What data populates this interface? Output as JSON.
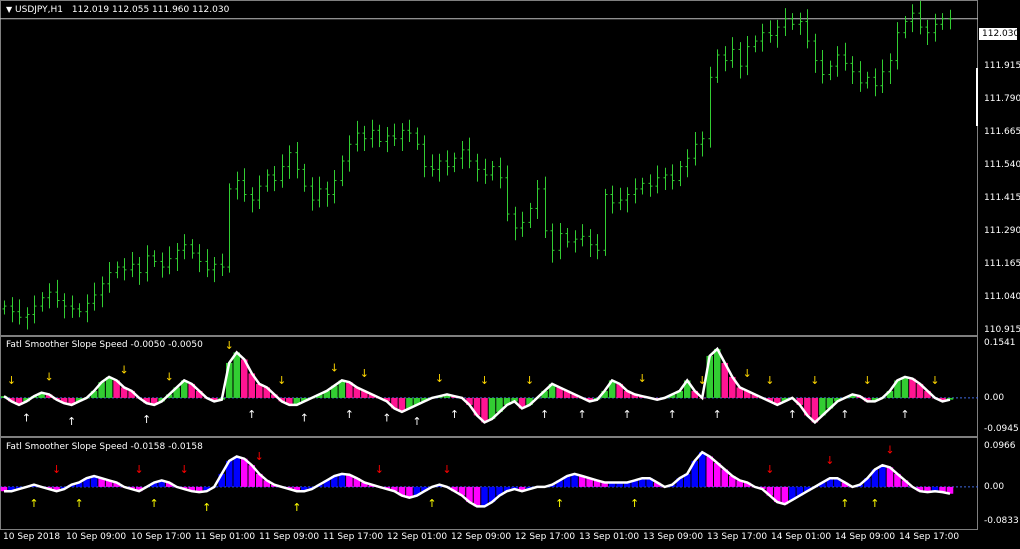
{
  "main_chart": {
    "symbol_label": "USDJPY,H1",
    "ohlc_label": "112.019 112.055 111.960 112.030",
    "dropdown_glyph": "▼",
    "current_price": "112.030",
    "price_ticks": [
      "111.915",
      "111.790",
      "111.665",
      "111.540",
      "111.415",
      "111.290",
      "111.165",
      "111.040",
      "110.915"
    ],
    "bar_color": "#32cd32",
    "price_line_color": "#c0c0c0"
  },
  "indicator1": {
    "title": "Fatl Smoother Slope Speed -0.0050 -0.0050",
    "ticks": [
      "0.1541",
      "0.00",
      "-0.0945"
    ],
    "colors": {
      "up": "#32cd32",
      "down": "#ff1493",
      "line": "#ffffff",
      "arrow_down": "#ffd700",
      "arrow_up": "#ffffff"
    }
  },
  "indicator2": {
    "title": "Fatl Smoother Slope Speed -0.0158 -0.0158",
    "ticks": [
      "0.0966",
      "0.00",
      "-0.0833"
    ],
    "colors": {
      "up": "#0000ff",
      "down": "#ff00ff",
      "line": "#ffffff",
      "arrow_down": "#ff0000",
      "arrow_up": "#ffff00"
    }
  },
  "time_axis": {
    "labels": [
      "10 Sep 2018",
      "10 Sep 09:00",
      "10 Sep 17:00",
      "11 Sep 01:00",
      "11 Sep 09:00",
      "11 Sep 17:00",
      "12 Sep 01:00",
      "12 Sep 09:00",
      "12 Sep 17:00",
      "13 Sep 01:00",
      "13 Sep 09:00",
      "13 Sep 17:00",
      "14 Sep 01:00",
      "14 Sep 09:00",
      "14 Sep 17:00"
    ]
  },
  "chart_data": [
    {
      "type": "ohlc",
      "title": "USDJPY,H1",
      "ylim": [
        110.9,
        112.09
      ],
      "close": [
        111.0,
        110.98,
        110.96,
        110.97,
        111.0,
        111.03,
        111.05,
        111.02,
        111.0,
        110.99,
        110.98,
        111.01,
        111.04,
        111.08,
        111.12,
        111.14,
        111.13,
        111.15,
        111.12,
        111.18,
        111.16,
        111.14,
        111.17,
        111.2,
        111.22,
        111.19,
        111.16,
        111.13,
        111.15,
        111.14,
        111.42,
        111.45,
        111.4,
        111.38,
        111.43,
        111.47,
        111.45,
        111.5,
        111.55,
        111.49,
        111.43,
        111.38,
        111.42,
        111.4,
        111.45,
        111.52,
        111.58,
        111.62,
        111.6,
        111.63,
        111.59,
        111.61,
        111.6,
        111.63,
        111.62,
        111.58,
        111.5,
        111.49,
        111.52,
        111.5,
        111.53,
        111.56,
        111.52,
        111.49,
        111.47,
        111.5,
        111.46,
        111.33,
        111.28,
        111.3,
        111.35,
        111.42,
        111.27,
        111.2,
        111.26,
        111.23,
        111.24,
        111.25,
        111.22,
        111.2,
        111.4,
        111.37,
        111.38,
        111.4,
        111.42,
        111.44,
        111.43,
        111.46,
        111.47,
        111.45,
        111.5,
        111.53,
        111.58,
        111.6,
        111.82,
        111.9,
        111.88,
        111.92,
        111.86,
        111.93,
        111.95,
        111.98,
        111.97,
        112.0,
        112.03,
        112.01,
        112.02,
        111.95,
        111.88,
        111.83,
        111.86,
        111.9,
        111.87,
        111.84,
        111.8,
        111.82,
        111.79,
        111.84,
        111.88,
        111.98,
        112.02,
        112.05,
        112.0,
        111.98,
        112.01,
        112.03,
        112.03
      ]
    },
    {
      "type": "histogram",
      "title": "Fatl Smoother Slope Speed -0.0050 -0.0050",
      "ylim": [
        -0.0945,
        0.1541
      ],
      "values": [
        0.005,
        -0.01,
        -0.02,
        -0.01,
        0.005,
        0.015,
        0.01,
        -0.005,
        -0.015,
        -0.02,
        -0.01,
        0.0,
        0.02,
        0.045,
        0.06,
        0.05,
        0.03,
        0.02,
        0.0,
        -0.015,
        -0.02,
        -0.01,
        0.01,
        0.03,
        0.05,
        0.04,
        0.02,
        0.0,
        -0.01,
        -0.005,
        0.1,
        0.13,
        0.11,
        0.07,
        0.04,
        0.03,
        0.01,
        -0.01,
        -0.02,
        -0.02,
        -0.01,
        0.0,
        0.01,
        0.02,
        0.035,
        0.05,
        0.045,
        0.03,
        0.02,
        0.01,
        0.0,
        -0.01,
        -0.03,
        -0.04,
        -0.03,
        -0.02,
        -0.01,
        0.0,
        0.005,
        0.01,
        0.005,
        0.0,
        -0.02,
        -0.05,
        -0.07,
        -0.06,
        -0.04,
        -0.02,
        -0.01,
        -0.03,
        -0.02,
        0.0,
        0.02,
        0.04,
        0.03,
        0.02,
        0.01,
        0.0,
        -0.01,
        -0.005,
        0.02,
        0.05,
        0.04,
        0.02,
        0.01,
        0.005,
        0.0,
        -0.005,
        0.0,
        0.01,
        0.02,
        0.05,
        0.02,
        0.0,
        0.12,
        0.14,
        0.1,
        0.06,
        0.03,
        0.02,
        0.01,
        0.0,
        -0.01,
        -0.02,
        -0.01,
        0.0,
        -0.02,
        -0.05,
        -0.07,
        -0.05,
        -0.03,
        -0.01,
        0.0,
        0.01,
        0.005,
        -0.01,
        -0.01,
        0.0,
        0.02,
        0.05,
        0.06,
        0.055,
        0.04,
        0.02,
        0.0,
        -0.01,
        -0.005
      ]
    },
    {
      "type": "histogram",
      "title": "Fatl Smoother Slope Speed -0.0158 -0.0158",
      "ylim": [
        -0.0833,
        0.0966
      ],
      "values": [
        -0.01,
        -0.01,
        -0.005,
        0.0,
        0.005,
        0.0,
        -0.005,
        -0.01,
        -0.005,
        0.005,
        0.01,
        0.02,
        0.025,
        0.02,
        0.015,
        0.01,
        0.0,
        -0.005,
        -0.01,
        0.0,
        0.01,
        0.015,
        0.01,
        0.0,
        -0.005,
        -0.01,
        -0.012,
        -0.01,
        0.0,
        0.03,
        0.06,
        0.07,
        0.065,
        0.05,
        0.03,
        0.015,
        0.005,
        0.0,
        -0.005,
        -0.01,
        -0.01,
        -0.005,
        0.005,
        0.015,
        0.025,
        0.03,
        0.028,
        0.02,
        0.01,
        0.005,
        0.0,
        -0.005,
        -0.01,
        -0.02,
        -0.025,
        -0.02,
        -0.01,
        0.0,
        0.005,
        0.0,
        -0.01,
        -0.02,
        -0.035,
        -0.045,
        -0.045,
        -0.035,
        -0.02,
        -0.01,
        -0.005,
        -0.01,
        -0.005,
        0.0,
        0.0,
        0.005,
        0.015,
        0.025,
        0.03,
        0.025,
        0.02,
        0.015,
        0.01,
        0.01,
        0.01,
        0.01,
        0.015,
        0.02,
        0.02,
        0.01,
        0.0,
        0.005,
        0.02,
        0.03,
        0.06,
        0.08,
        0.07,
        0.055,
        0.04,
        0.025,
        0.015,
        0.01,
        0.0,
        -0.005,
        -0.02,
        -0.035,
        -0.04,
        -0.03,
        -0.02,
        -0.01,
        0.0,
        0.01,
        0.02,
        0.02,
        0.01,
        0.0,
        0.005,
        0.02,
        0.04,
        0.05,
        0.045,
        0.03,
        0.015,
        0.0,
        -0.01,
        -0.012,
        -0.01,
        -0.012,
        -0.0158
      ]
    }
  ]
}
